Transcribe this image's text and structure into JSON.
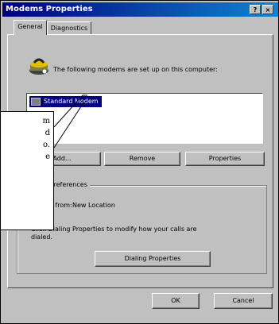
{
  "window": {
    "title": "Modems Properties",
    "help_button": "?",
    "close_button": "×"
  },
  "tabs": [
    {
      "label": "General",
      "active": true
    },
    {
      "label": "Diagnostics",
      "active": false
    }
  ],
  "general": {
    "intro_text": "The following modems are set up on this computer:",
    "modems": [
      "Standard Modem"
    ],
    "buttons": {
      "add": "Add...",
      "remove": "Remove",
      "properties": "Properties"
    }
  },
  "dialing": {
    "group_label": "Dialing preferences",
    "dialing_from_label": "Dialing from:",
    "dialing_from_value": "New Location",
    "help_text_line1": "Click Dialing Properties to modify how your calls are",
    "help_text_line2": "dialed.",
    "dialing_properties_button": "Dialing Properties"
  },
  "footer": {
    "ok": "OK",
    "cancel": "Cancel"
  },
  "callout": {
    "lines": [
      "m",
      "d",
      "o.",
      "e"
    ]
  },
  "colors": {
    "titlebar_start": "#00007b",
    "titlebar_end": "#1084d0",
    "face": "#c0c0c0",
    "selection": "#000080"
  }
}
